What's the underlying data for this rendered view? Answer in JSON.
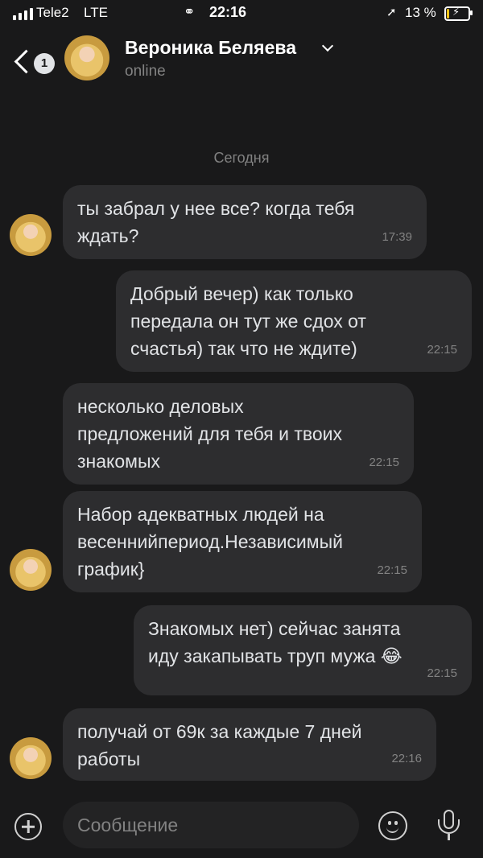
{
  "status_bar": {
    "carrier": "Tele2",
    "network": "LTE",
    "time": "22:16",
    "battery_percent": "13 %",
    "battery_level": 0.13
  },
  "header": {
    "unread_count": "1",
    "contact_name": "Вероника Беляева",
    "contact_status": "online"
  },
  "date_separator": "Сегодня",
  "messages": [
    {
      "text": "ты забрал у нее все? когда тебя\nждать?",
      "time": "17:39"
    },
    {
      "text": "Добрый вечер) как только\nпередала он тут же сдох от\nсчастья) так что не ждите)",
      "time": "22:15"
    },
    {
      "text": "несколько деловых\nпредложений для тебя и твоих\nзнакомых",
      "time": "22:15"
    },
    {
      "text": "Набор адекватных людей на\nвесеннийпериод.Независимый\nграфик}",
      "time": "22:15"
    },
    {
      "text": "Знакомых нет) сейчас занята\nиду закапывать труп мужа 😂",
      "time": "22:15"
    },
    {
      "text": "получай от 69к за каждые 7 дней\nработы",
      "time": "22:16"
    }
  ],
  "composer": {
    "placeholder": "Сообщение"
  },
  "icons": [
    "signal-icon",
    "link-icon",
    "location-arrow-icon",
    "battery-icon",
    "back-chevron-icon",
    "chevron-down-icon",
    "plus-circle-icon",
    "emoji-icon",
    "microphone-icon"
  ]
}
